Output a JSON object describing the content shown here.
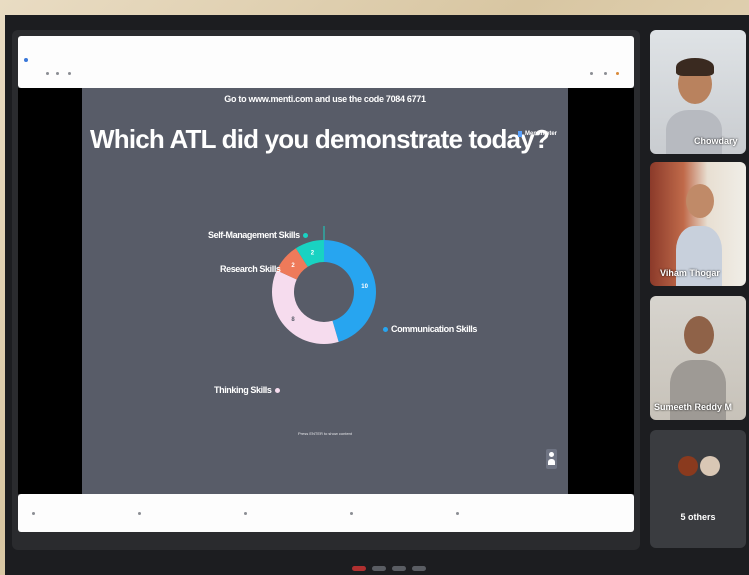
{
  "slide": {
    "join_instruction": "Go to www.menti.com and use the code 7084 6771",
    "question": "Which ATL did you demonstrate today?",
    "brand": "Mentimeter",
    "footer_note": "Press ENTER to show content"
  },
  "chart_data": {
    "type": "pie",
    "subtype": "donut",
    "title": "Which ATL did you demonstrate today?",
    "categories": [
      "Communication Skills",
      "Thinking Skills",
      "Research Skills",
      "Self-Management Skills"
    ],
    "values": [
      10,
      8,
      2,
      2
    ],
    "colors": [
      "#27a5f0",
      "#f6dcee",
      "#ee7a5a",
      "#19d2c2"
    ]
  },
  "participants": [
    {
      "name": "Chowdary"
    },
    {
      "name": "Viham Thogar"
    },
    {
      "name": "Sumeeth Reddy M"
    }
  ],
  "others": {
    "label": "5 others"
  },
  "colors": {
    "slide_bg": "#585c68",
    "frame_bg": "#1c1d20",
    "accent_blue": "#27a5f0"
  }
}
